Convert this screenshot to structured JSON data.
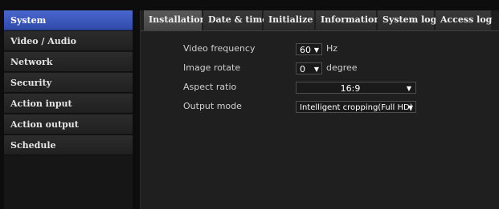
{
  "sidebar": {
    "items": [
      {
        "label": "System",
        "active": true
      },
      {
        "label": "Video / Audio",
        "active": false
      },
      {
        "label": "Network",
        "active": false
      },
      {
        "label": "Security",
        "active": false
      },
      {
        "label": "Action input",
        "active": false
      },
      {
        "label": "Action output",
        "active": false
      },
      {
        "label": "Schedule",
        "active": false
      }
    ]
  },
  "tabs": [
    {
      "label": "Installation",
      "active": true
    },
    {
      "label": "Date & time",
      "active": false
    },
    {
      "label": "Initialize",
      "active": false
    },
    {
      "label": "Information",
      "active": false
    },
    {
      "label": "System log",
      "active": false
    },
    {
      "label": "Access log",
      "active": false
    }
  ],
  "settings": {
    "video_frequency": {
      "label": "Video frequency",
      "value": "60",
      "unit": "Hz"
    },
    "image_rotate": {
      "label": "Image rotate",
      "value": "0",
      "unit": "degree"
    },
    "aspect_ratio": {
      "label": "Aspect ratio",
      "value": "16:9"
    },
    "output_mode": {
      "label": "Output mode",
      "value": "Intelligent cropping(Full HD)"
    }
  },
  "colors": {
    "accent": "#3b58c0",
    "background": "#0d0d0d",
    "panel": "#1f1f1f"
  }
}
